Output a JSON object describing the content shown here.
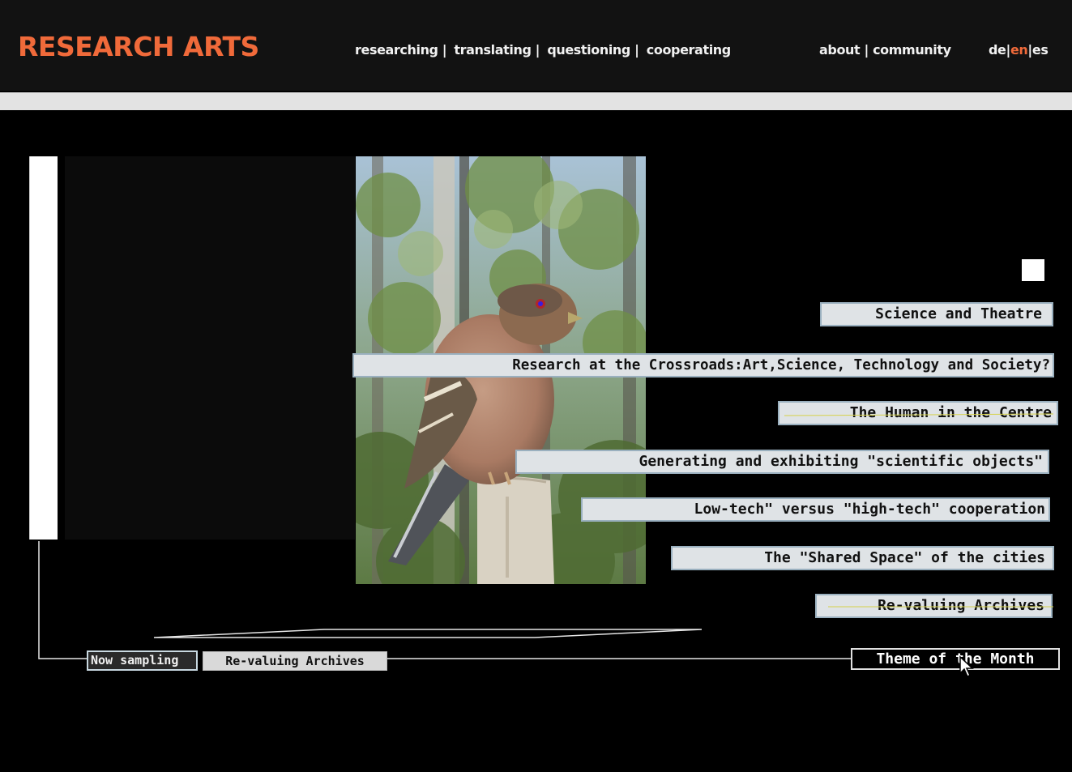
{
  "header": {
    "logo": "RESEARCH ARTS",
    "nav_main": [
      {
        "label": "researching",
        "sep": " | "
      },
      {
        "label": "translating",
        "sep": " | "
      },
      {
        "label": "questioning",
        "sep": " | "
      },
      {
        "label": "cooperating",
        "sep": ""
      }
    ],
    "nav_secondary": [
      {
        "label": "about",
        "sep": " | "
      },
      {
        "label": "community",
        "sep": ""
      }
    ],
    "languages": {
      "de": "de",
      "en": "en",
      "es": "es",
      "sep": "|",
      "active": "en"
    }
  },
  "topics": [
    "Science and Theatre",
    "Research at the Crossroads:Art,Science, Technology and Society?",
    "The Human in the Centre",
    "Generating and exhibiting \"scientific objects\"",
    "Low-tech\" versus \"high-tech\" cooperation",
    "The \"Shared Space\" of the cities",
    "Re-valuing Archives"
  ],
  "sampling": {
    "label": "Now sampling",
    "value": "Re-valuing Archives"
  },
  "theme_of_month": "Theme of the Month",
  "colors": {
    "accent": "#f06a3a",
    "header_bg": "#121212",
    "topic_bg": "#dfe3e6",
    "topic_border": "#9ab0bf"
  }
}
